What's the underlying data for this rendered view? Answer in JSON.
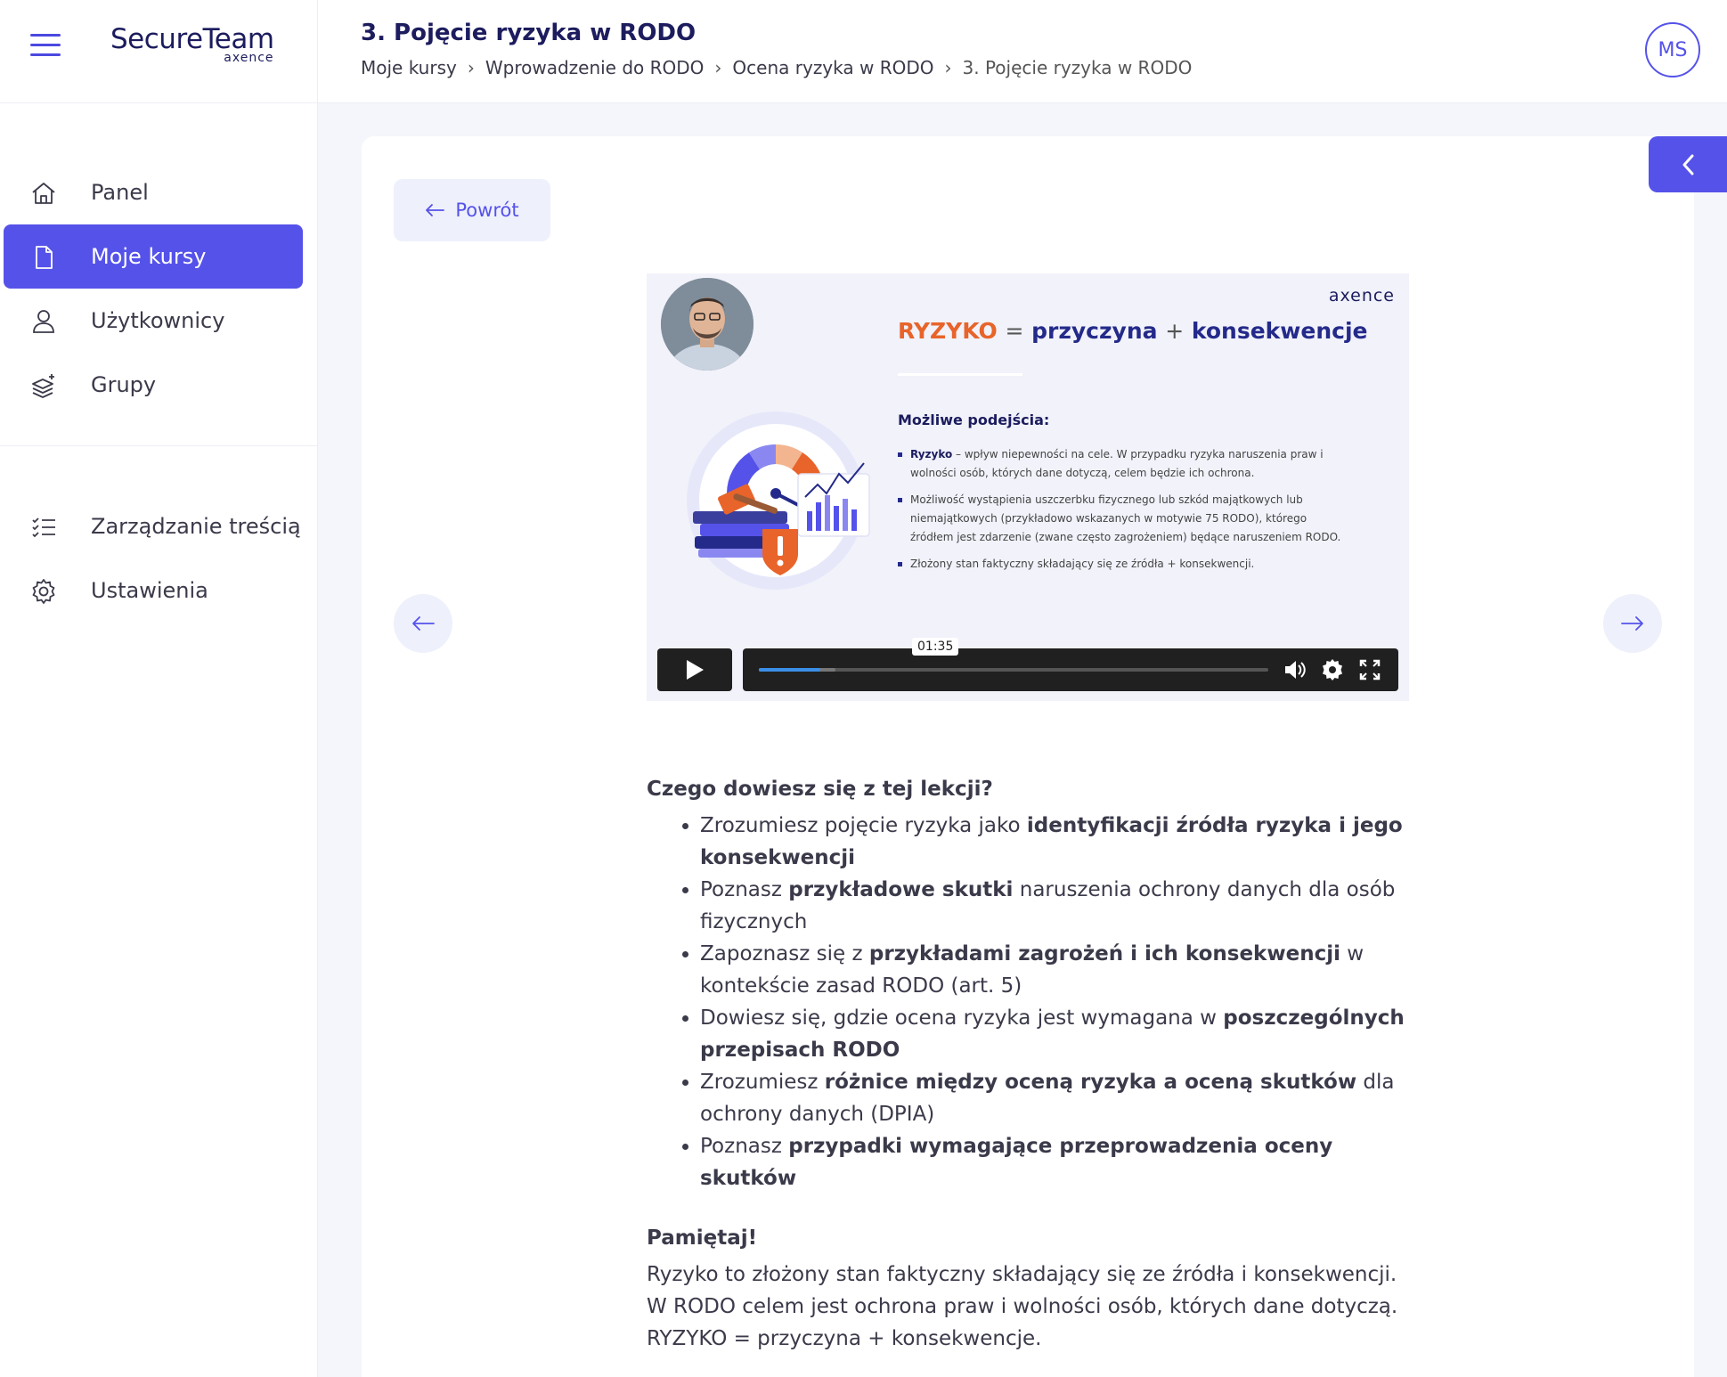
{
  "app": {
    "logo_main": "SecureTeam",
    "logo_sub": "axence"
  },
  "sidebar": {
    "main_items": [
      {
        "label": "Panel",
        "icon": "home-icon",
        "active": false
      },
      {
        "label": "Moje kursy",
        "icon": "document-icon",
        "active": true
      },
      {
        "label": "Użytkownicy",
        "icon": "user-icon",
        "active": false
      },
      {
        "label": "Grupy",
        "icon": "layers-icon",
        "active": false
      }
    ],
    "secondary_items": [
      {
        "label": "Zarządzanie treścią",
        "icon": "checklist-icon"
      },
      {
        "label": "Ustawienia",
        "icon": "gear-icon"
      }
    ]
  },
  "header": {
    "title": "3. Pojęcie ryzyka w RODO",
    "breadcrumb": [
      "Moje kursy",
      "Wprowadzenie do RODO",
      "Ocena ryzyka w RODO",
      "3. Pojęcie ryzyka w RODO"
    ],
    "avatar_initials": "MS"
  },
  "content": {
    "back_label": "Powrót"
  },
  "video": {
    "brand": "axence",
    "heading_risk": "RYZYKO",
    "heading_eq": "=",
    "heading_cause": "przyczyna",
    "heading_plus": "+",
    "heading_consequence": "konsekwencje",
    "approaches_title": "Możliwe podejścia:",
    "approach_1_bold": "Ryzyko",
    "approach_1_text": " – wpływ niepewności na cele. W przypadku ryzyka naruszenia praw i wolności osób, których dane dotyczą, celem będzie ich ochrona.",
    "approach_2": "Możliwość wystąpienia uszczerbku fizycznego lub szkód majątkowych lub niemajątkowych (przykładowo wskazanych w motywie 75 RODO), którego źródłem jest zdarzenie (zwane często zagrożeniem) będące naruszeniem RODO.",
    "approach_3": "Złożony stan faktyczny składający się ze źródła + konsekwencji.",
    "time": "01:35",
    "progress": 0.12,
    "buffered": 0.15
  },
  "lesson": {
    "learn_heading": "Czego dowiesz się z tej lekcji?",
    "items": [
      {
        "pre": "Zrozumiesz pojęcie ryzyka jako ",
        "bold": "identyfikacji źródła ryzyka i jego konsekwencji",
        "post": ""
      },
      {
        "pre": "Poznasz ",
        "bold": "przykładowe skutki",
        "post": " naruszenia ochrony danych dla osób fizycznych"
      },
      {
        "pre": "Zapoznasz się z ",
        "bold": "przykładami zagrożeń i ich konsekwencji",
        "post": " w kontekście zasad RODO (art. 5)"
      },
      {
        "pre": "Dowiesz się, gdzie ocena ryzyka jest wymagana w ",
        "bold": "poszczególnych przepisach RODO",
        "post": ""
      },
      {
        "pre": "Zrozumiesz ",
        "bold": "różnice między oceną ryzyka a oceną skutków",
        "post": " dla ochrony danych (DPIA)"
      },
      {
        "pre": "Poznasz ",
        "bold": "przypadki wymagające przeprowadzenia oceny skutków",
        "post": ""
      }
    ],
    "remember_heading": "Pamiętaj!",
    "remember_line_1": "Ryzyko to złożony stan faktyczny składający się ze źródła i konsekwencji.",
    "remember_line_2": "W RODO celem jest ochrona praw i wolności osób, których dane dotyczą.",
    "remember_line_3": "RYZYKO = przyczyna + konsekwencje."
  },
  "colors": {
    "accent": "#5552ea",
    "brand_dark": "#1c1c5e",
    "risk_orange": "#e8642a"
  }
}
